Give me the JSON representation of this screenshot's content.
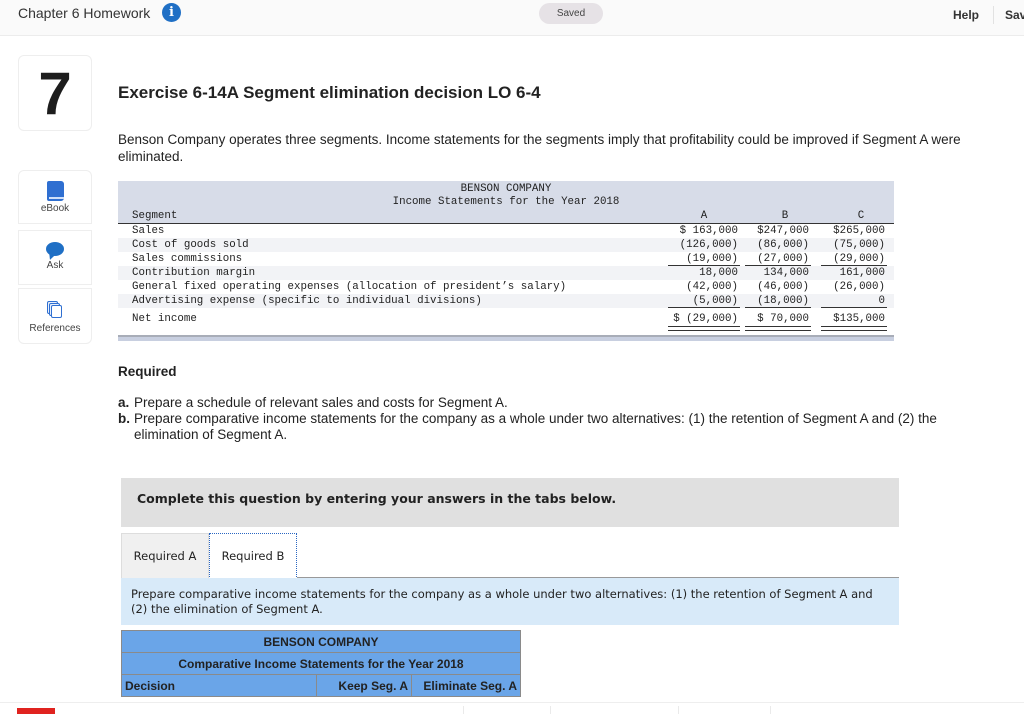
{
  "topbar": {
    "title": "Chapter 6 Homework",
    "info_icon": "i",
    "saved_status": "Saved",
    "help_label": "Help",
    "save_exit_label": "Save & Exit"
  },
  "rail": {
    "question_number": "7",
    "buttons": [
      {
        "icon": "book-icon",
        "label": "eBook"
      },
      {
        "icon": "chat-bubble-icon",
        "label": "Ask"
      },
      {
        "icon": "documents-icon",
        "label": "References"
      }
    ]
  },
  "exercise": {
    "title": "Exercise 6-14A Segment elimination decision LO 6-4",
    "intro": "Benson Company operates three segments. Income statements for the segments imply that profitability could be improved if Segment A were eliminated."
  },
  "statement": {
    "company": "BENSON COMPANY",
    "subtitle": "Income Statements for the Year 2018",
    "segment_label": "Segment",
    "columns": [
      "A",
      "B",
      "C"
    ],
    "rows": [
      {
        "label": "Sales",
        "values": [
          "$ 163,000",
          "$247,000",
          "$265,000"
        ]
      },
      {
        "label": "Cost of goods sold",
        "values": [
          "(126,000)",
          "(86,000)",
          "(75,000)"
        ]
      },
      {
        "label": "Sales commissions",
        "values": [
          "(19,000)",
          "(27,000)",
          "(29,000)"
        ]
      },
      {
        "label": "Contribution margin",
        "values": [
          "18,000",
          "134,000",
          "161,000"
        ]
      },
      {
        "label": "General fixed operating expenses (allocation of president’s salary)",
        "values": [
          "(42,000)",
          "(46,000)",
          "(26,000)"
        ]
      },
      {
        "label": "Advertising expense (specific to individual divisions)",
        "values": [
          "(5,000)",
          "(18,000)",
          "0"
        ]
      },
      {
        "label": "Net income",
        "values": [
          "$ (29,000)",
          "$ 70,000",
          "$135,000"
        ]
      }
    ]
  },
  "required": {
    "title": "Required",
    "items": [
      {
        "marker": "a.",
        "text": "Prepare a schedule of relevant sales and costs for Segment A."
      },
      {
        "marker": "b.",
        "text": "Prepare comparative income statements for the company as a whole under two alternatives: (1) the retention of Segment A and (2) the elimination of Segment A."
      }
    ]
  },
  "instructions": "Complete this question by entering your answers in the tabs below.",
  "tabs": [
    {
      "label": "Required A",
      "active": false
    },
    {
      "label": "Required B",
      "active": true
    }
  ],
  "tab_panel_text": "Prepare comparative income statements for the company as a whole under two alternatives: (1) the retention of Segment A and (2) the elimination of Segment A.",
  "comparative_table": {
    "company": "BENSON COMPANY",
    "subtitle": "Comparative Income Statements for the Year 2018",
    "headers": [
      "Decision",
      "Keep Seg. A",
      "Eliminate Seg. A"
    ]
  },
  "colors": {
    "accent_blue": "#1f6fc5",
    "table_header_blue": "#6aa5e8",
    "panel_blue": "#d8eaf9",
    "statement_header": "#d7dce8",
    "instruction_gray": "#e0e0e0"
  }
}
